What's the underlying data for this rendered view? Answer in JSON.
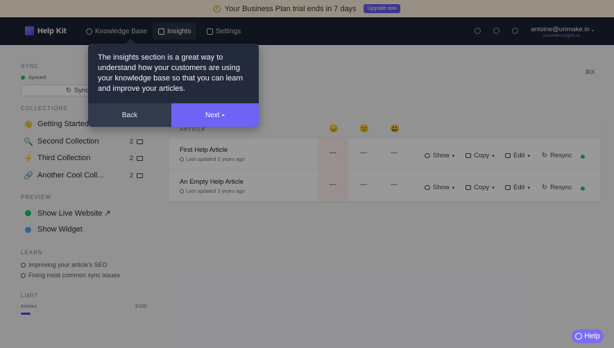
{
  "banner": {
    "text": "Your Business Plan trial ends in 7 days",
    "upgrade_label": "Upgrade now"
  },
  "nav": {
    "app_name": "Help Kit",
    "items": [
      {
        "label": "Knowledge Base",
        "icon": "globe-icon"
      },
      {
        "label": "Insights",
        "icon": "chart-icon",
        "active": true
      },
      {
        "label": "Settings",
        "icon": "sliders-icon"
      }
    ],
    "icons": [
      "bell-icon",
      "broadcast-icon",
      "support-icon"
    ],
    "user_email": "antoine@unmake.io",
    "user_domain": "usermake.helpkit.so"
  },
  "sidebar": {
    "sync_title": "SYNC",
    "sync_status": "Synced",
    "sync_button": "Sync",
    "collections_title": "COLLECTIONS",
    "collections": [
      {
        "emoji": "👋",
        "label": "Getting Started",
        "count": ""
      },
      {
        "emoji": "🔍",
        "label": "Second Collection",
        "count": "2"
      },
      {
        "emoji": "⚡",
        "label": "Third Collection",
        "count": "2"
      },
      {
        "emoji": "🔗",
        "label": "Another Cool Coll...",
        "count": "2"
      }
    ],
    "preview_title": "PREVIEW",
    "preview": [
      {
        "label": "Show Live Website ↗",
        "color": "#22c55e"
      },
      {
        "label": "Show Widget",
        "color": "#60a5fa"
      }
    ],
    "learn_title": "LEARN",
    "learn": [
      {
        "label": "Improving your article's SEO"
      },
      {
        "label": "Fixing most common sync issues"
      }
    ],
    "limit_title": "LIMIT",
    "limit_label": "Articles",
    "limit_value": "3/100",
    "limit_fraction": 0.03
  },
  "main": {
    "shortcut": "⌘K",
    "table": {
      "column_article": "ARTICLE",
      "faces": [
        "😞",
        "😐",
        "😃"
      ],
      "rows": [
        {
          "title": "First Help Article",
          "updated": "Last updated 2 years ago",
          "ratings": [
            "—",
            "—",
            "—"
          ]
        },
        {
          "title": "An Empty Help Article",
          "updated": "Last updated 2 years ago",
          "ratings": [
            "—",
            "—",
            "—"
          ]
        }
      ],
      "actions": {
        "show": "Show",
        "copy": "Copy",
        "edit": "Edit",
        "resync": "Resync"
      }
    }
  },
  "tooltip": {
    "text": "The insights section is a great way to understand how your customers are using your knowledge base so that you can learn and improve your articles.",
    "back_label": "Back",
    "next_label": "Next"
  },
  "help": {
    "label": "Help"
  },
  "colors": {
    "accent": "#6d63f5",
    "nav_bg": "#1c2233",
    "banner_bg": "#fdf1dc",
    "synced": "#22c55e"
  }
}
